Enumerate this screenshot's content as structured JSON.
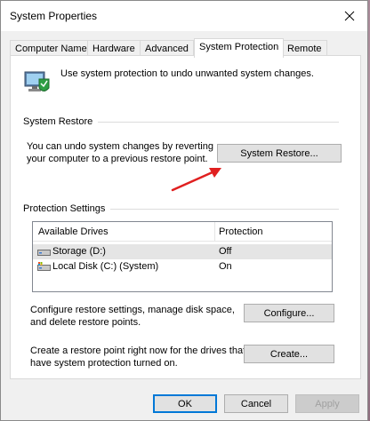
{
  "window": {
    "title": "System Properties"
  },
  "tabs": [
    {
      "label": "Computer Name"
    },
    {
      "label": "Hardware"
    },
    {
      "label": "Advanced"
    },
    {
      "label": "System Protection"
    },
    {
      "label": "Remote"
    }
  ],
  "intro": {
    "text": "Use system protection to undo unwanted system changes."
  },
  "system_restore": {
    "group_title": "System Restore",
    "description_line1": "You can undo system changes by reverting",
    "description_line2": "your computer to a previous restore point.",
    "button_label": "System Restore..."
  },
  "protection_settings": {
    "group_title": "Protection Settings",
    "columns": [
      "Available Drives",
      "Protection"
    ],
    "drives": [
      {
        "name": "Storage (D:)",
        "protection": "Off",
        "icon": "drive-icon"
      },
      {
        "name": "Local Disk (C:) (System)",
        "protection": "On",
        "icon": "system-drive-icon"
      }
    ],
    "configure_text_line1": "Configure restore settings, manage disk space,",
    "configure_text_line2": "and delete restore points.",
    "configure_button": "Configure...",
    "create_text_line1": "Create a restore point right now for the drives that",
    "create_text_line2": "have system protection turned on.",
    "create_button": "Create..."
  },
  "footer": {
    "ok": "OK",
    "cancel": "Cancel",
    "apply": "Apply"
  },
  "colors": {
    "focus_blue": "#0078d7",
    "annotation_arrow": "#e02020"
  }
}
